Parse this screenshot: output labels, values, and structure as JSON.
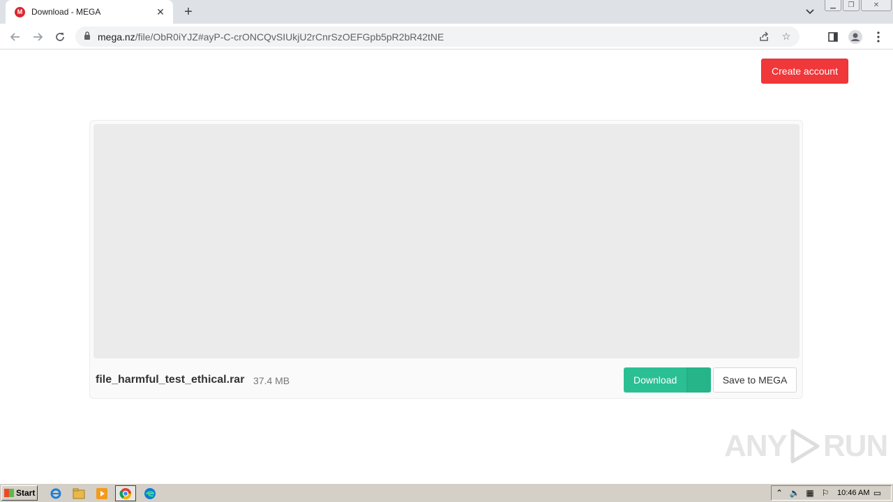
{
  "browser": {
    "tab_title": "Download - MEGA",
    "favicon_letter": "M",
    "url_host": "mega.nz",
    "url_path": "/file/ObR0iYJZ#ayP-C-crONCQvSIUkjU2rCnrSzOEFGpb5pR2bR42tNE"
  },
  "page": {
    "create_account_label": "Create account",
    "file_name": "file_harmful_test_ethical.rar",
    "file_size": "37.4 MB",
    "download_label": "Download",
    "save_label": "Save to MEGA",
    "accent_red": "#f0373a",
    "accent_green": "#2bbf94"
  },
  "watermark": {
    "left_text": "ANY",
    "right_text": "RUN"
  },
  "taskbar": {
    "start_label": "Start",
    "clock": "10:46 AM"
  }
}
